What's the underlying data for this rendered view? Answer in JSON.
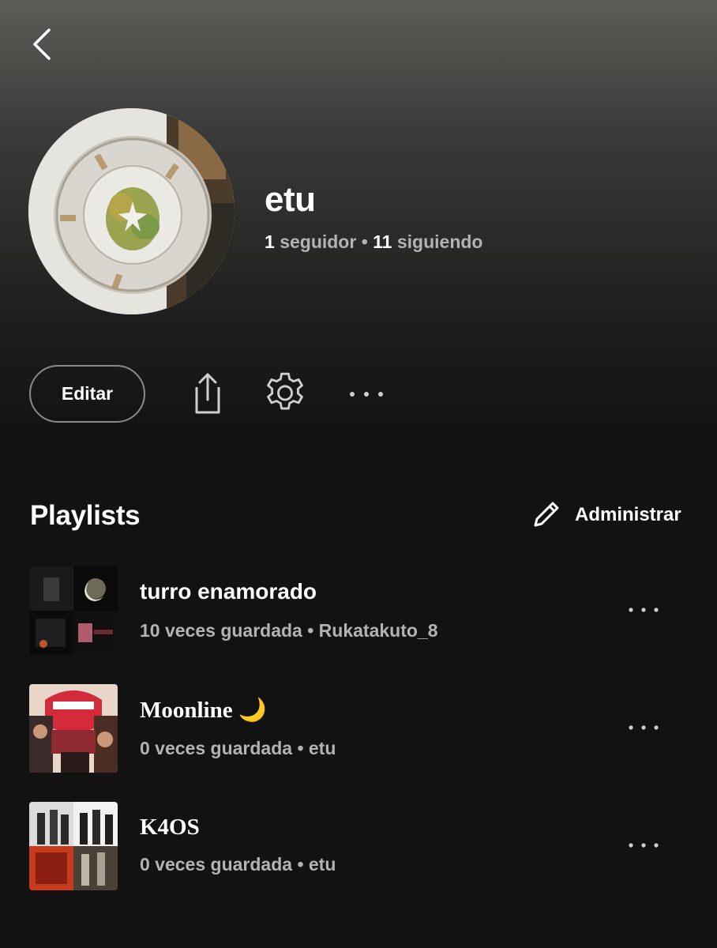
{
  "header": {
    "back_icon": "chevron-left-icon"
  },
  "profile": {
    "name": "etu",
    "followers_count": "1",
    "followers_label": "seguidor",
    "separator": "•",
    "following_count": "11",
    "following_label": "siguiendo"
  },
  "actions": {
    "edit_label": "Editar",
    "share_icon": "share-icon",
    "settings_icon": "gear-icon",
    "more_icon": "more-horizontal-icon"
  },
  "playlists_section": {
    "title": "Playlists",
    "manage_label": "Administrar",
    "manage_icon": "pencil-icon",
    "items": [
      {
        "title": "turro enamorado",
        "subtitle": "10 veces guardada • Rukatakuto_8"
      },
      {
        "title": "Moonline 🌙",
        "subtitle": "0 veces guardada • etu"
      },
      {
        "title": "K4OS",
        "subtitle": "0 veces guardada • etu"
      }
    ]
  },
  "colors": {
    "background": "#121212",
    "text_primary": "#ffffff",
    "text_secondary": "#b3b3b3",
    "button_border": "#8a8a8a"
  }
}
